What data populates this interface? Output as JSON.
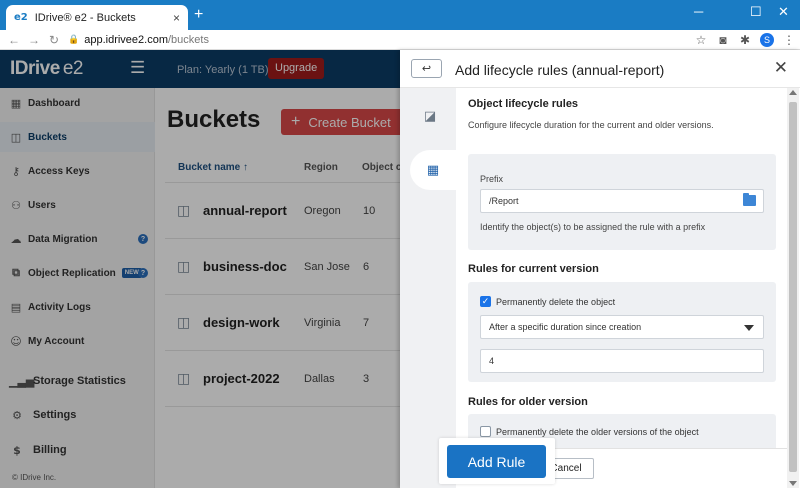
{
  "browser": {
    "tab_favicon": "e2",
    "tab_title": "IDrive® e2 - Buckets",
    "tab_close": "×",
    "new_tab": "+",
    "win_min": "─",
    "win_max": "☐",
    "win_close": "✕",
    "url_host": "app.idrivee2.com",
    "url_path": "/buckets",
    "profile_initial": "S"
  },
  "header": {
    "logo_main": "IDrive",
    "logo_suffix": "e2",
    "plan": "Plan: Yearly (1 TB)",
    "upgrade_label": "Upgrade"
  },
  "sidebar": {
    "items": [
      {
        "label": "Dashboard"
      },
      {
        "label": "Buckets"
      },
      {
        "label": "Access Keys"
      },
      {
        "label": "Users"
      },
      {
        "label": "Data Migration"
      },
      {
        "label": "Object Replication",
        "badge": "NEW"
      },
      {
        "label": "Activity Logs"
      },
      {
        "label": "My Account"
      },
      {
        "label": "Storage Statistics"
      },
      {
        "label": "Settings"
      },
      {
        "label": "Billing"
      }
    ],
    "help_glyph": "?",
    "copyright": "© IDrive Inc."
  },
  "main": {
    "title": "Buckets",
    "create_label": "Create Bucket",
    "create_plus": "+",
    "columns": {
      "name": "Bucket name",
      "sort_arrow": "↑",
      "region": "Region",
      "objects": "Object c"
    },
    "rows": [
      {
        "name": "annual-report",
        "region": "Oregon",
        "count": "10"
      },
      {
        "name": "business-doc",
        "region": "San Jose",
        "count": "6"
      },
      {
        "name": "design-work",
        "region": "Virginia",
        "count": "7"
      },
      {
        "name": "project-2022",
        "region": "Dallas",
        "count": "3"
      }
    ]
  },
  "panel": {
    "title": "Add lifecycle rules (annual-report)",
    "back_glyph": "↩",
    "close_glyph": "✕",
    "section_object": {
      "title": "Object lifecycle rules",
      "desc": "Configure lifecycle duration for the current and older versions."
    },
    "prefix": {
      "label": "Prefix",
      "value": "/Report",
      "hint": "Identify the object(s) to be assigned the rule with a prefix"
    },
    "current": {
      "title": "Rules for current version",
      "delete_label": "Permanently delete the object",
      "delete_checked": true,
      "duration_option": "After a specific duration since creation",
      "duration_value": "4"
    },
    "older": {
      "title": "Rules for older version",
      "delete_label": "Permanently delete the older versions of the object",
      "delete_checked": false
    },
    "add_rule_label": "Add Rule",
    "cancel_label": "Cancel"
  },
  "colors": {
    "titlebar": "#1a7cc4",
    "app_header": "#0b3c66",
    "create_button": "#d94848",
    "upgrade_button": "#a01c1c",
    "primary_button": "#1a73c4"
  }
}
